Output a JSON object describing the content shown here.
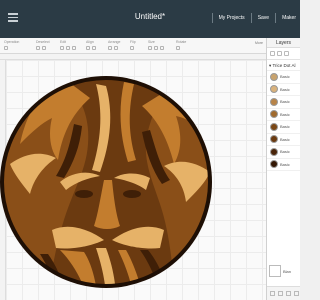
{
  "header": {
    "title": "Untitled*",
    "links": [
      "My Projects",
      "Save",
      "Maker"
    ]
  },
  "toolbar": {
    "groups": [
      "Operation",
      "Deselect",
      "Edit",
      "Align",
      "Arrange",
      "Flip",
      "Size",
      "Rotate"
    ],
    "more_label": "More"
  },
  "layers_panel": {
    "title": "Layers",
    "group_label": "Trice Dot Al",
    "layers": [
      {
        "label": "Basic",
        "color": "#c8a36e"
      },
      {
        "label": "Basic",
        "color": "#d9b27c"
      },
      {
        "label": "Basic",
        "color": "#b88448"
      },
      {
        "label": "Basic",
        "color": "#a06a2e"
      },
      {
        "label": "Basic",
        "color": "#7a4716"
      },
      {
        "label": "Basic",
        "color": "#6a3a10"
      },
      {
        "label": "Basic",
        "color": "#4a250a"
      },
      {
        "label": "Basic",
        "color": "#331705"
      }
    ],
    "blank_label": "Blan"
  },
  "canvas": {
    "colors": {
      "background": "#8a4f18",
      "outline": "#1e0f05",
      "dark": "#3f1f07",
      "mid": "#6b3a10",
      "light": "#c37d2e",
      "pale": "#e6b268"
    }
  }
}
